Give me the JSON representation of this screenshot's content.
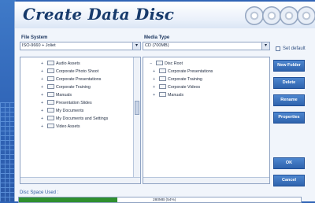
{
  "title": "Create Data Disc",
  "file_system": {
    "label": "File System",
    "value": "ISO-9660 + Joliet"
  },
  "media_type": {
    "label": "Media Type",
    "value": "CD (700MB)"
  },
  "set_default": "Set default",
  "left_tree": [
    "Audio Assets",
    "Corporate Photo Shoot",
    "Corporate Presentations",
    "Corporate Training",
    "Manuals",
    "Presentation Slides",
    "My Documents",
    "My Documents and Settings",
    "Video Assets"
  ],
  "right_tree": {
    "root": "Disc Root",
    "items": [
      "Corporate Presentations",
      "Corporate Training",
      "Corporate Videos",
      "Manuals"
    ]
  },
  "buttons": {
    "new_folder": "New Folder",
    "delete": "Delete",
    "rename": "Rename",
    "properties": "Properties",
    "ok": "OK",
    "cancel": "Cancel"
  },
  "disc_space": {
    "label": "Disc Space Used :",
    "value_text": "280MB (54%)",
    "fraction": 0.35
  }
}
